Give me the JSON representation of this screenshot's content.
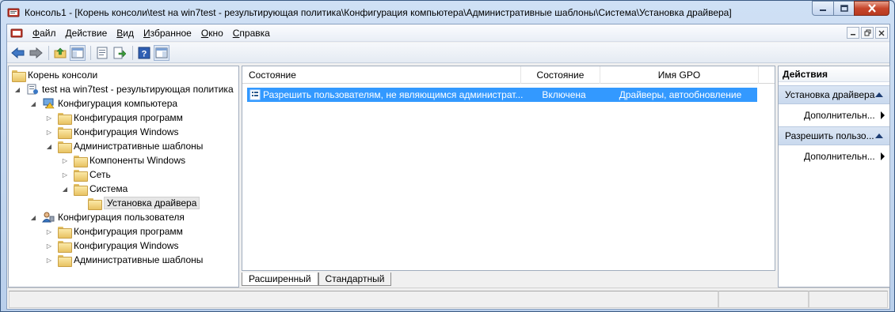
{
  "window": {
    "title": "Консоль1 - [Корень консоли\\test на win7test - результирующая политика\\Конфигурация компьютера\\Административные шаблоны\\Система\\Установка драйвера]"
  },
  "menu": {
    "items": [
      {
        "accel": "Ф",
        "rest": "айл"
      },
      {
        "accel": "Д",
        "rest": "ействие"
      },
      {
        "accel": "В",
        "rest": "ид"
      },
      {
        "accel": "И",
        "rest": "збранное"
      },
      {
        "accel": "О",
        "rest": "кно"
      },
      {
        "accel": "С",
        "rest": "правка"
      }
    ]
  },
  "tree": {
    "items": [
      {
        "label": "Корень консоли"
      },
      {
        "label": "test на win7test - результирующая политика"
      },
      {
        "label": "Конфигурация компьютера"
      },
      {
        "label": "Конфигурация программ"
      },
      {
        "label": "Конфигурация Windows"
      },
      {
        "label": "Административные шаблоны"
      },
      {
        "label": "Компоненты Windows"
      },
      {
        "label": "Сеть"
      },
      {
        "label": "Система"
      },
      {
        "label": "Установка драйвера"
      },
      {
        "label": "Конфигурация пользователя"
      },
      {
        "label": "Конфигурация программ"
      },
      {
        "label": "Конфигурация Windows"
      },
      {
        "label": "Административные шаблоны"
      }
    ]
  },
  "list": {
    "columns": [
      "Состояние",
      "Состояние",
      "Имя GPO"
    ],
    "rows": [
      {
        "name": "Разрешить пользователям, не являющимся администрат...",
        "state": "Включена",
        "gpo": "Драйверы, автообновление"
      }
    ]
  },
  "tabs": [
    "Расширенный",
    "Стандартный"
  ],
  "actions": {
    "title": "Действия",
    "sections": [
      {
        "label": "Установка драйвера",
        "item": "Дополнительн..."
      },
      {
        "label": "Разрешить пользо...",
        "item": "Дополнительн..."
      }
    ]
  },
  "icons": {
    "back": "back-arrow-icon",
    "forward": "forward-arrow-icon",
    "up": "up-folder-icon",
    "console_tree": "show-hide-tree-icon",
    "properties": "properties-icon",
    "export": "export-list-icon",
    "help": "help-icon",
    "action_pane": "show-hide-action-pane-icon"
  },
  "colors": {
    "selection": "#3399ff",
    "title_gradient_top": "#cfe0f5",
    "close_button": "#c7462c"
  }
}
